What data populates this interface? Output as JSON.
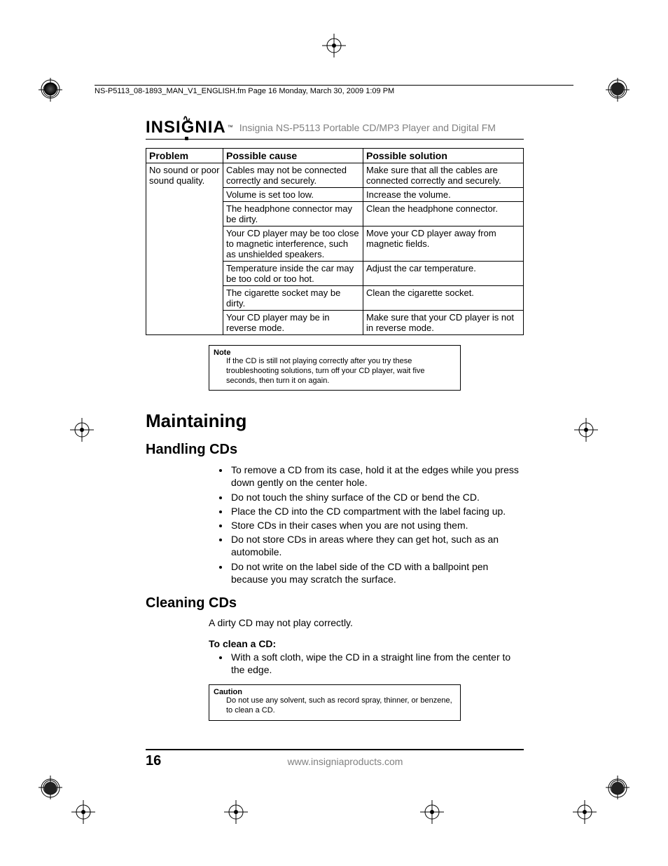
{
  "fm_header": "NS-P5113_08-1893_MAN_V1_ENGLISH.fm  Page 16  Monday, March 30, 2009  1:09 PM",
  "brand": "INSIGNIA",
  "product_title": "Insignia NS-P5113 Portable CD/MP3 Player and Digital FM",
  "table": {
    "headers": {
      "problem": "Problem",
      "cause": "Possible cause",
      "solution": "Possible solution"
    },
    "problem": "No sound or poor sound quality.",
    "rows": [
      {
        "cause": "Cables may not be connected correctly and securely.",
        "solution": "Make sure that all the cables are connected correctly and securely."
      },
      {
        "cause": "Volume is set too low.",
        "solution": "Increase the volume."
      },
      {
        "cause": "The headphone connector may be dirty.",
        "solution": "Clean the headphone connector."
      },
      {
        "cause": "Your CD player may be too close to magnetic interference, such as unshielded speakers.",
        "solution": "Move your CD player away from magnetic fields."
      },
      {
        "cause": "Temperature inside the car may be too cold or too hot.",
        "solution": "Adjust the car temperature."
      },
      {
        "cause": "The cigarette socket may be dirty.",
        "solution": "Clean the cigarette socket."
      },
      {
        "cause": "Your CD player may be in reverse mode.",
        "solution": "Make sure that your CD player is not in reverse mode."
      }
    ]
  },
  "note": {
    "title": "Note",
    "body": "If the CD is still not playing correctly after you try these troubleshooting solutions, turn off your CD player, wait five seconds, then turn it on again."
  },
  "sections": {
    "maintaining": "Maintaining",
    "handling": {
      "title": "Handling CDs",
      "items": [
        "To remove a CD from its case, hold it at the edges while you press down gently on the center hole.",
        "Do not touch the shiny surface of the CD or bend the CD.",
        "Place the CD into the CD compartment with the label facing up.",
        "Store CDs in their cases when you are not using them.",
        "Do not store CDs in areas where they can get hot, such as an automobile.",
        "Do not write on the label side of the CD with a ballpoint pen because you may scratch the surface."
      ]
    },
    "cleaning": {
      "title": "Cleaning CDs",
      "intro": "A dirty CD may not play correctly.",
      "lead": "To clean a CD:",
      "items": [
        "With a soft cloth, wipe the CD in a straight line from the center to the edge."
      ]
    }
  },
  "caution": {
    "title": "Caution",
    "body": "Do not use any solvent, such as record spray, thinner, or benzene, to clean a CD."
  },
  "footer": {
    "page": "16",
    "url": "www.insigniaproducts.com"
  }
}
